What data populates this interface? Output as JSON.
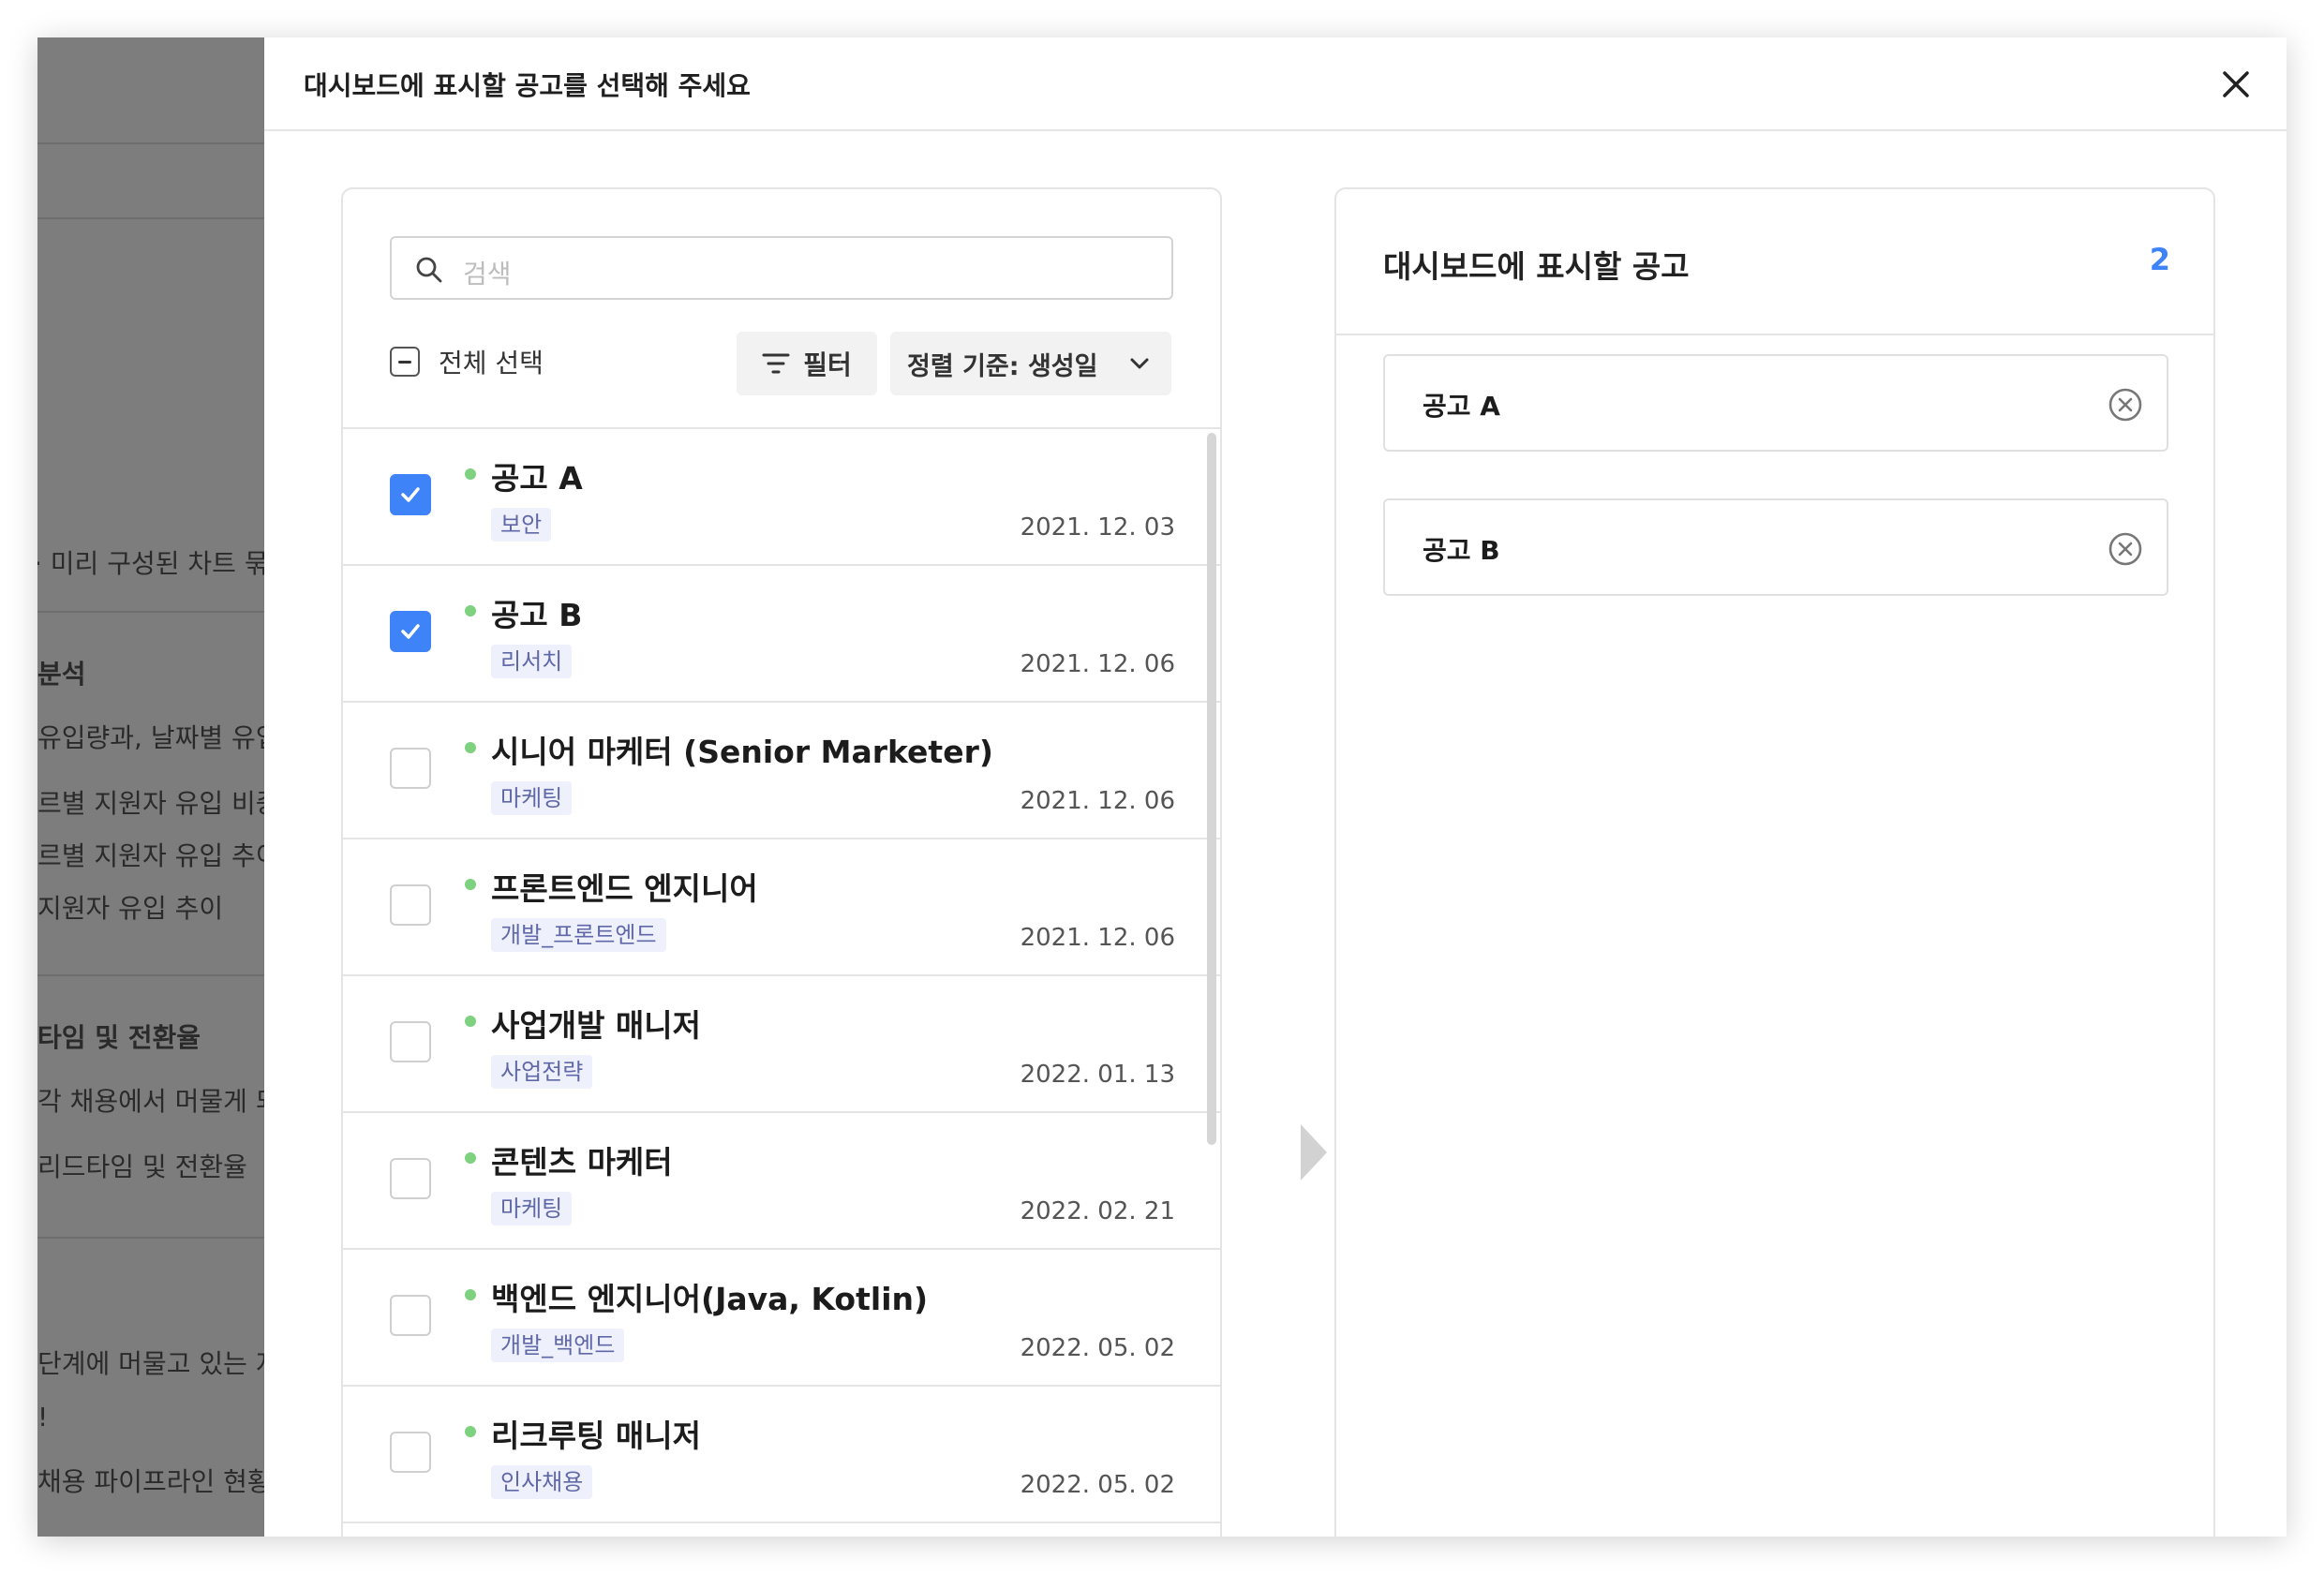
{
  "background": {
    "items": [
      {
        "text": "· 미리 구성된 차트 묶",
        "bold": false
      },
      {
        "text": "분석",
        "bold": true
      },
      {
        "text": "유입량과, 날짜별 유입",
        "bold": false
      },
      {
        "text": "르별 지원자 유입 비중",
        "bold": false
      },
      {
        "text": "르별 지원자 유입 추이",
        "bold": false
      },
      {
        "text": "지원자 유입 추이",
        "bold": false
      },
      {
        "text": "타임 및 전환율",
        "bold": true
      },
      {
        "text": "각 채용에서 머물게 되",
        "bold": false
      },
      {
        "text": "리드타임 및 전환율",
        "bold": false
      },
      {
        "text": "단계에 머물고 있는 지",
        "bold": false
      },
      {
        "text": "!",
        "bold": false
      },
      {
        "text": "채용 파이프라인 현황",
        "bold": false
      }
    ]
  },
  "modal": {
    "title": "대시보드에 표시할 공고를 선택해 주세요",
    "close_icon": "close-icon"
  },
  "left": {
    "search_placeholder": "검색",
    "select_all_label": "전체 선택",
    "filter_label": "필터",
    "sort_label": "정렬 기준: 생성일",
    "status_color": "#7ed17e",
    "items": [
      {
        "title": "공고 A",
        "tag": "보안",
        "date": "2021. 12. 03",
        "checked": true
      },
      {
        "title": "공고 B",
        "tag": "리서치",
        "date": "2021. 12. 06",
        "checked": true
      },
      {
        "title": "시니어 마케터 (Senior Marketer)",
        "tag": "마케팅",
        "date": "2021. 12. 06",
        "checked": false
      },
      {
        "title": "프론트엔드 엔지니어",
        "tag": "개발_프론트엔드",
        "date": "2021. 12. 06",
        "checked": false
      },
      {
        "title": "사업개발 매니저",
        "tag": "사업전략",
        "date": "2022. 01. 13",
        "checked": false
      },
      {
        "title": "콘텐츠 마케터",
        "tag": "마케팅",
        "date": "2022. 02. 21",
        "checked": false
      },
      {
        "title": "백엔드 엔지니어(Java, Kotlin)",
        "tag": "개발_백엔드",
        "date": "2022. 05. 02",
        "checked": false
      },
      {
        "title": "리크루팅 매니저",
        "tag": "인사채용",
        "date": "2022. 05. 02",
        "checked": false
      }
    ]
  },
  "right": {
    "title": "대시보드에 표시할 공고",
    "count": "2",
    "accent_color": "#3f83f8",
    "selected": [
      {
        "label": "공고 A"
      },
      {
        "label": "공고 B"
      }
    ]
  }
}
